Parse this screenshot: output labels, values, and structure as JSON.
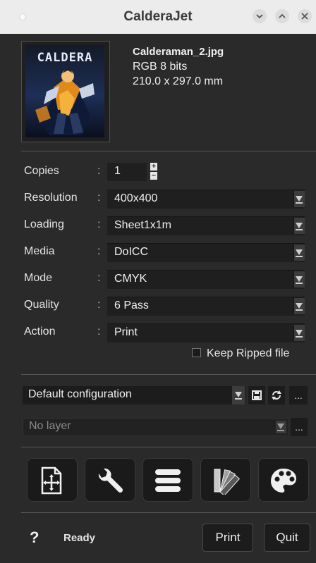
{
  "window": {
    "title": "CalderaJet"
  },
  "file": {
    "thumbnail_title": "CALDERA",
    "name": "Calderaman_2.jpg",
    "color": "RGB 8 bits",
    "size": "210.0 x 297.0 mm"
  },
  "settings": {
    "copies": {
      "label": "Copies",
      "value": "1"
    },
    "resolution": {
      "label": "Resolution",
      "value": "400x400"
    },
    "loading": {
      "label": "Loading",
      "value": "Sheet1x1m"
    },
    "media": {
      "label": "Media",
      "value": "DoICC"
    },
    "mode": {
      "label": "Mode",
      "value": "CMYK"
    },
    "quality": {
      "label": "Quality",
      "value": "6 Pass"
    },
    "action": {
      "label": "Action",
      "value": "Print"
    },
    "keep_ripped": {
      "label": "Keep Ripped file",
      "checked": false
    }
  },
  "config": {
    "value": "Default configuration",
    "more": "..."
  },
  "layer": {
    "value": "No layer",
    "more": "..."
  },
  "tools": [
    "open-file-icon",
    "wrench-icon",
    "list-icon",
    "color-swatches-icon",
    "palette-icon"
  ],
  "footer": {
    "help": "?",
    "status": "Ready",
    "print_label": "Print",
    "quit_label": "Quit"
  },
  "colors": {
    "titlebar": "#ececec",
    "panel": "#2a2a2a",
    "field": "#1f1f1f"
  }
}
